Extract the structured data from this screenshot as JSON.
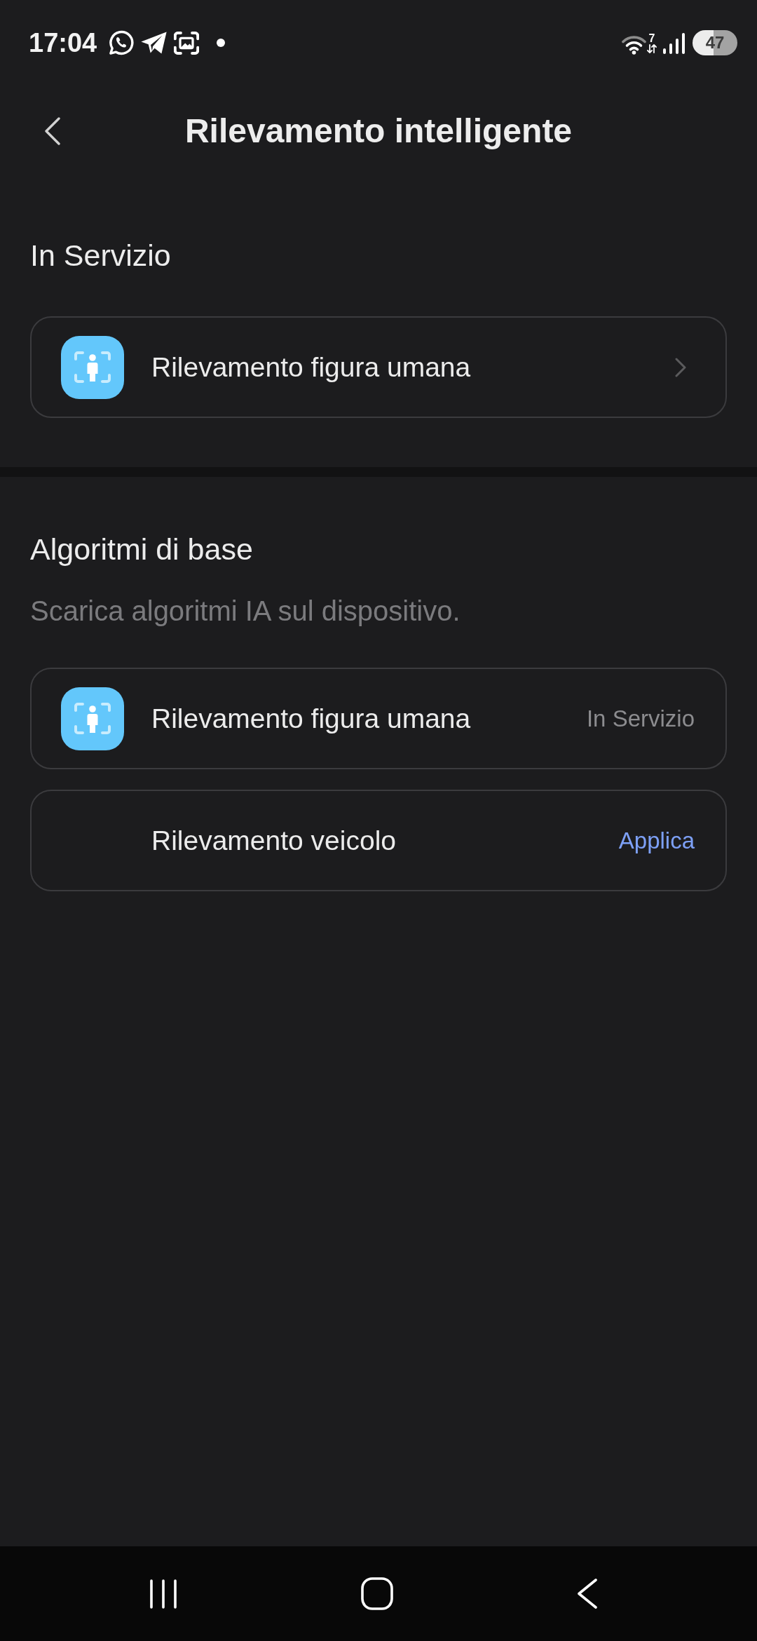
{
  "status_bar": {
    "time": "17:04",
    "wifi_label": "7",
    "battery": "47"
  },
  "header": {
    "title": "Rilevamento intelligente"
  },
  "sections": [
    {
      "title": "In Servizio",
      "items": [
        {
          "label": "Rilevamento figura umana",
          "has_icon": true,
          "kind": "chevron"
        }
      ]
    },
    {
      "title": "Algoritmi di base",
      "description": "Scarica algoritmi IA sul dispositivo.",
      "items": [
        {
          "label": "Rilevamento figura umana",
          "has_icon": true,
          "kind": "status",
          "trailing": "In Servizio"
        },
        {
          "label": "Rilevamento veicolo",
          "has_icon": false,
          "kind": "action",
          "trailing": "Applica"
        }
      ]
    }
  ]
}
